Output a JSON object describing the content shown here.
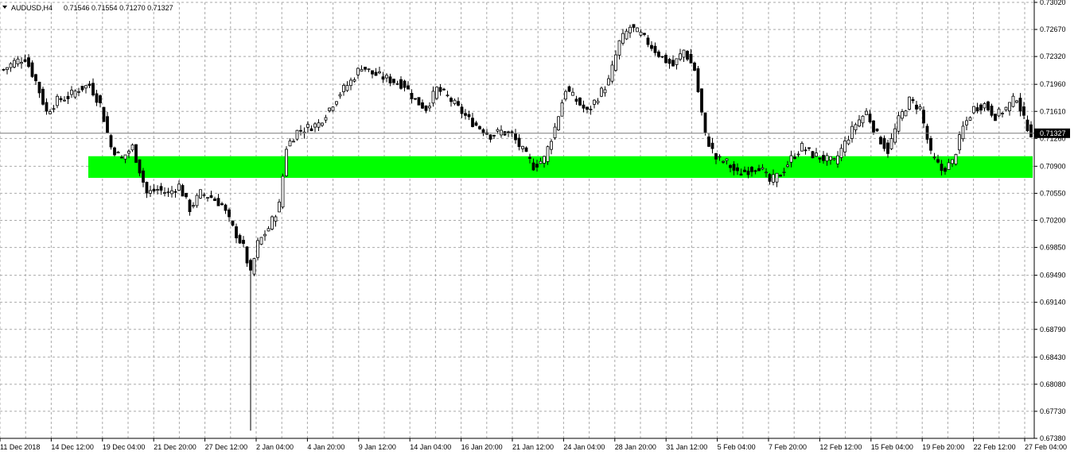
{
  "header": {
    "symbol": "AUDUSD,H4",
    "ohlc": "0.71546 0.71554 0.71270 0.71327"
  },
  "colors": {
    "background": "#ffffff",
    "grid": "#a9a9a9",
    "candle": "#000000",
    "zone": "#00ff00",
    "price_line": "#7a7a7a",
    "price_tag": "#000000"
  },
  "chart_data": {
    "type": "candlestick",
    "symbol": "AUDUSD",
    "timeframe": "H4",
    "grid": true,
    "ylim": [
      0.6738,
      0.7302
    ],
    "y_ticks": [
      "0.73020",
      "0.72670",
      "0.72320",
      "0.71960",
      "0.71610",
      "0.71260",
      "0.70900",
      "0.70550",
      "0.70200",
      "0.69850",
      "0.69490",
      "0.69140",
      "0.68790",
      "0.68430",
      "0.68080",
      "0.67730",
      "0.67380"
    ],
    "x_ticks": [
      "11 Dec 2018",
      "14 Dec 12:00",
      "19 Dec 04:00",
      "21 Dec 20:00",
      "27 Dec 12:00",
      "2 Jan 04:00",
      "4 Jan 20:00",
      "9 Jan 12:00",
      "14 Jan 04:00",
      "16 Jan 20:00",
      "21 Jan 12:00",
      "24 Jan 04:00",
      "28 Jan 20:00",
      "31 Jan 12:00",
      "5 Feb 04:00",
      "7 Feb 20:00",
      "12 Feb 12:00",
      "15 Feb 04:00",
      "19 Feb 20:00",
      "22 Feb 12:00",
      "27 Feb 04:00"
    ],
    "current_price": "0.71327",
    "support_zone": [
      0.7075,
      0.7103
    ],
    "approx_close_path": [
      [
        0,
        0.7215
      ],
      [
        3,
        0.7225
      ],
      [
        6,
        0.723
      ],
      [
        9,
        0.72
      ],
      [
        12,
        0.716
      ],
      [
        15,
        0.7175
      ],
      [
        18,
        0.718
      ],
      [
        21,
        0.719
      ],
      [
        24,
        0.7195
      ],
      [
        27,
        0.717
      ],
      [
        30,
        0.7115
      ],
      [
        33,
        0.71
      ],
      [
        36,
        0.7115
      ],
      [
        38,
        0.7085
      ],
      [
        40,
        0.7055
      ],
      [
        43,
        0.706
      ],
      [
        46,
        0.7055
      ],
      [
        49,
        0.7065
      ],
      [
        52,
        0.7035
      ],
      [
        55,
        0.7055
      ],
      [
        58,
        0.705
      ],
      [
        61,
        0.704
      ],
      [
        64,
        0.701
      ],
      [
        67,
        0.6985
      ],
      [
        69,
        0.695
      ],
      [
        71,
        0.699
      ],
      [
        74,
        0.701
      ],
      [
        77,
        0.704
      ],
      [
        79,
        0.7115
      ],
      [
        82,
        0.7135
      ],
      [
        85,
        0.714
      ],
      [
        88,
        0.7145
      ],
      [
        91,
        0.7165
      ],
      [
        94,
        0.7185
      ],
      [
        97,
        0.72
      ],
      [
        100,
        0.722
      ],
      [
        103,
        0.721
      ],
      [
        106,
        0.7205
      ],
      [
        109,
        0.72
      ],
      [
        112,
        0.7195
      ],
      [
        115,
        0.7175
      ],
      [
        118,
        0.7165
      ],
      [
        121,
        0.719
      ],
      [
        124,
        0.718
      ],
      [
        127,
        0.7165
      ],
      [
        130,
        0.715
      ],
      [
        133,
        0.714
      ],
      [
        136,
        0.713
      ],
      [
        139,
        0.7135
      ],
      [
        142,
        0.713
      ],
      [
        145,
        0.711
      ],
      [
        148,
        0.709
      ],
      [
        151,
        0.71
      ],
      [
        154,
        0.714
      ],
      [
        157,
        0.719
      ],
      [
        160,
        0.7175
      ],
      [
        163,
        0.716
      ],
      [
        166,
        0.718
      ],
      [
        169,
        0.72
      ],
      [
        172,
        0.725
      ],
      [
        175,
        0.727
      ],
      [
        178,
        0.726
      ],
      [
        181,
        0.7245
      ],
      [
        184,
        0.723
      ],
      [
        187,
        0.722
      ],
      [
        190,
        0.724
      ],
      [
        193,
        0.7215
      ],
      [
        196,
        0.713
      ],
      [
        199,
        0.71
      ],
      [
        202,
        0.7095
      ],
      [
        205,
        0.708
      ],
      [
        208,
        0.7085
      ],
      [
        211,
        0.709
      ],
      [
        214,
        0.707
      ],
      [
        217,
        0.708
      ],
      [
        220,
        0.71
      ],
      [
        223,
        0.7115
      ],
      [
        226,
        0.7105
      ],
      [
        229,
        0.71
      ],
      [
        232,
        0.7095
      ],
      [
        235,
        0.712
      ],
      [
        238,
        0.7145
      ],
      [
        241,
        0.716
      ],
      [
        244,
        0.713
      ],
      [
        247,
        0.711
      ],
      [
        250,
        0.715
      ],
      [
        253,
        0.7175
      ],
      [
        256,
        0.7165
      ],
      [
        259,
        0.7105
      ],
      [
        262,
        0.7085
      ],
      [
        265,
        0.7095
      ],
      [
        268,
        0.714
      ],
      [
        271,
        0.7165
      ],
      [
        274,
        0.717
      ],
      [
        277,
        0.7155
      ],
      [
        280,
        0.7165
      ],
      [
        283,
        0.718
      ],
      [
        285,
        0.715
      ],
      [
        287,
        0.7133
      ]
    ]
  }
}
